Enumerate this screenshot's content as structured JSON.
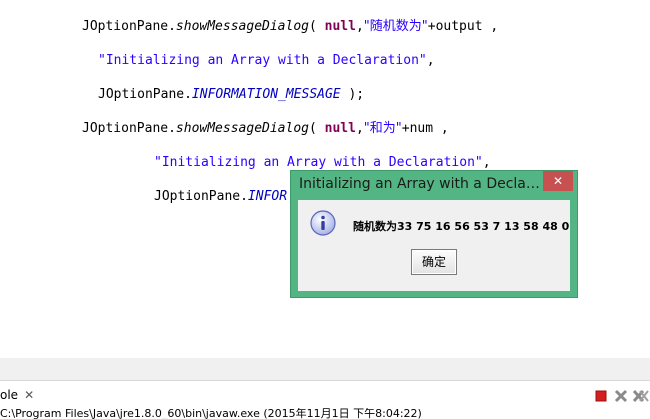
{
  "code": {
    "line1": {
      "obj": "JOptionPane.",
      "method": "showMessageDialog",
      "open": "( ",
      "null": "null",
      "comma": ",",
      "str": "\"随机数为\"",
      "rest": "+output ,"
    },
    "line2": {
      "str": "\"Initializing an Array with a Declaration\"",
      "rest": ","
    },
    "line3": {
      "obj": "JOptionPane.",
      "const": "INFORMATION_MESSAGE",
      "rest": " );"
    },
    "line4": {
      "obj": "JOptionPane.",
      "method": "showMessageDialog",
      "open": "( ",
      "null": "null",
      "comma": ",",
      "str": "\"和为\"",
      "rest": "+num ,"
    },
    "line5": {
      "str": "\"Initializing an Array with a Declaration\"",
      "rest": ","
    },
    "line6": {
      "obj": "JOptionPane.",
      "const": "INFOR"
    }
  },
  "dialog": {
    "title": "Initializing an Array with a Decla…",
    "close_label": "✕",
    "icon": "info-icon",
    "message": "随机数为33 75 16 56 53 7 13 58 48 0",
    "ok_label": "确定"
  },
  "console": {
    "tab_label": "ole",
    "tab_close": "✕",
    "path": "C:\\Program Files\\Java\\jre1.8.0_60\\bin\\javaw.exe (2015年11月1日 下午8:04:22)",
    "terminate_icon": "stop-icon",
    "remove_icon": "remove-launch-icon",
    "remove_all_icon": "remove-all-icon"
  }
}
